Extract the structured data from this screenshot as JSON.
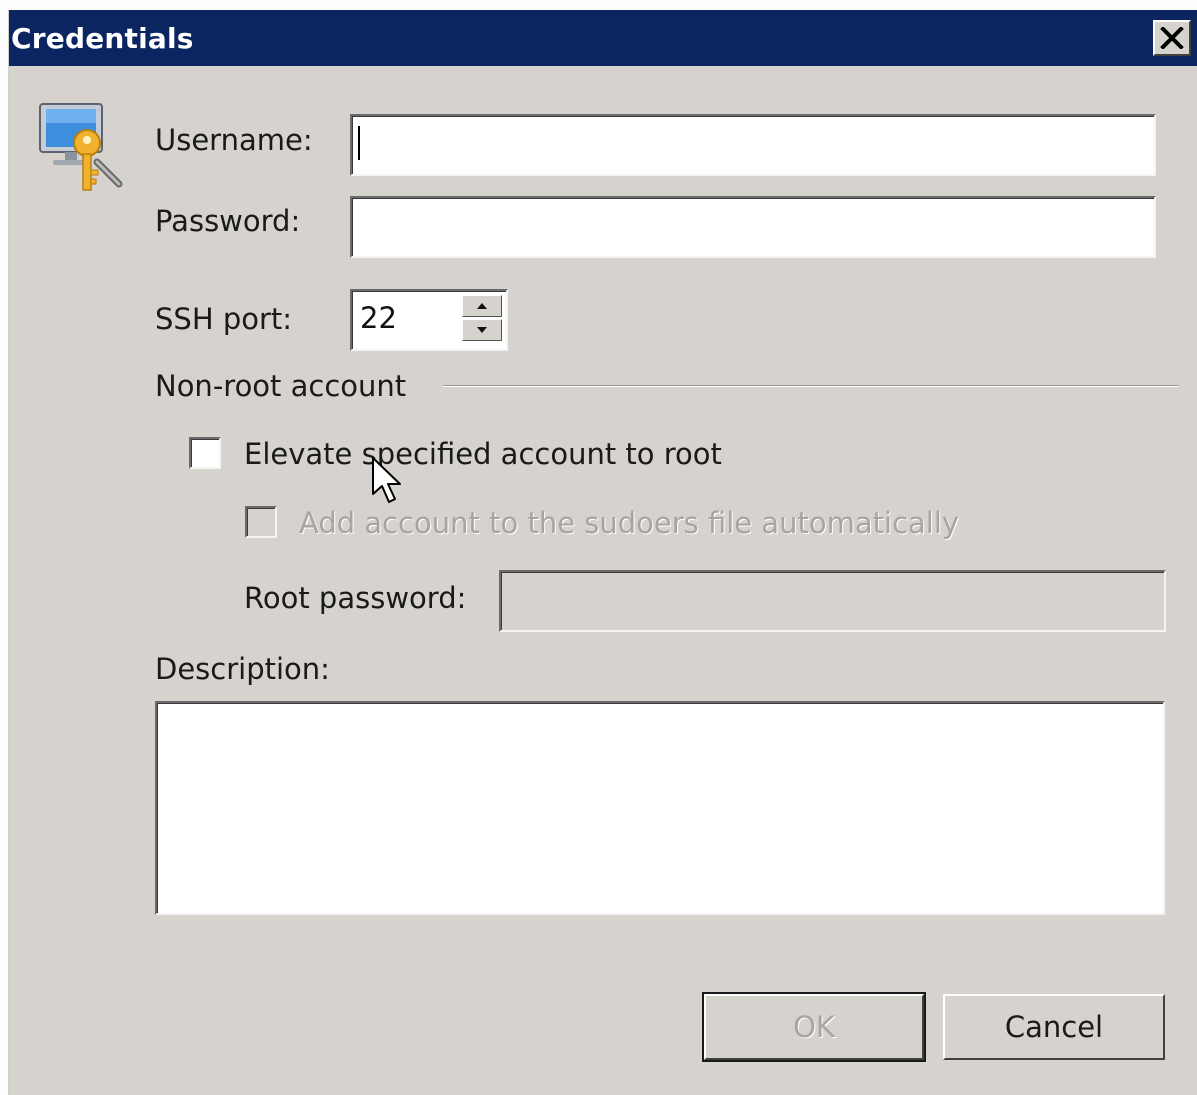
{
  "dialog": {
    "title": "Credentials",
    "icon": "computer-key-icon"
  },
  "form": {
    "username_label": "Username:",
    "username_value": "",
    "password_label": "Password:",
    "password_value": "",
    "ssh_port_label": "SSH port:",
    "ssh_port_value": "22",
    "nonroot_group_label": "Non-root account",
    "elevate_label": "Elevate specified account to root",
    "elevate_checked": false,
    "sudoers_label": "Add account to the sudoers file automatically",
    "sudoers_checked": false,
    "sudoers_disabled": true,
    "root_password_label": "Root password:",
    "root_password_value": "",
    "root_password_disabled": true,
    "description_label": "Description:",
    "description_value": ""
  },
  "buttons": {
    "ok_label": "OK",
    "ok_disabled": true,
    "cancel_label": "Cancel"
  },
  "colors": {
    "titlebar": "#0b2561",
    "dialog_bg": "#d6d3ce",
    "disabled_text": "#a7a5a1"
  }
}
